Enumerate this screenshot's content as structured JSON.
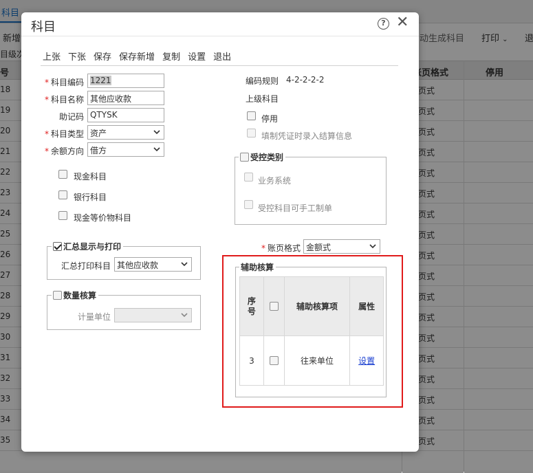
{
  "background": {
    "tab": "科目",
    "toolbar": {
      "new": "新增",
      "auto_generate": "动生成科目",
      "print": "打印",
      "exit": "退"
    },
    "sub_label": "目级次",
    "columns": {
      "seq": "号",
      "ledger_format": "账页格式",
      "disabled": "停用"
    },
    "rows": [
      {
        "num": "18",
        "format": "页式"
      },
      {
        "num": "19",
        "format": "页式"
      },
      {
        "num": "20",
        "format": "页式"
      },
      {
        "num": "21",
        "format": "页式"
      },
      {
        "num": "22",
        "format": "页式"
      },
      {
        "num": "23",
        "format": "页式"
      },
      {
        "num": "24",
        "format": "页式"
      },
      {
        "num": "25",
        "format": "页式"
      },
      {
        "num": "26",
        "format": "页式"
      },
      {
        "num": "27",
        "format": "页式"
      },
      {
        "num": "28",
        "format": "页式"
      },
      {
        "num": "29",
        "format": "页式"
      },
      {
        "num": "30",
        "format": "页式"
      },
      {
        "num": "31",
        "format": "页式"
      },
      {
        "num": "32",
        "format": "页式"
      },
      {
        "num": "33",
        "format": "页式"
      },
      {
        "num": "34",
        "format": "页式"
      },
      {
        "num": "35",
        "format": "页式"
      }
    ]
  },
  "dialog": {
    "title": "科目",
    "help_icon": "question-circle-icon",
    "close_icon": "close-icon",
    "toolbar": [
      "上张",
      "下张",
      "保存",
      "保存新增",
      "复制",
      "设置",
      "退出"
    ],
    "form": {
      "code_label": "科目编码",
      "code_value": "1221",
      "name_label": "科目名称",
      "name_value": "其他应收款",
      "mnemonic_label": "助记码",
      "mnemonic_value": "QTYSK",
      "type_label": "科目类型",
      "type_value": "资产",
      "balance_label": "余额方向",
      "balance_value": "借方",
      "cash_label": "现金科目",
      "bank_label": "银行科目",
      "cash_equiv_label": "现金等价物科目"
    },
    "right": {
      "code_rule_label": "编码规则",
      "code_rule_value": "4-2-2-2-2",
      "parent_label": "上级科目",
      "disabled_label": "停用",
      "settlement_label": "填制凭证时录入结算信息"
    },
    "controlled": {
      "legend": "受控类别",
      "business_system": "业务系统",
      "manual_voucher": "受控科目可手工制单"
    },
    "summary": {
      "legend": "汇总显示与打印",
      "print_label": "汇总打印科目",
      "print_value": "其他应收款"
    },
    "quantity": {
      "legend": "数量核算",
      "unit_label": "计量单位",
      "unit_value": ""
    },
    "ledger_format": {
      "label": "账页格式",
      "value": "金额式"
    },
    "aux": {
      "legend": "辅助核算",
      "headers": {
        "seq": "序号",
        "item": "辅助核算项",
        "attr": "属性"
      },
      "rows": [
        {
          "seq": "3",
          "item": "往来单位",
          "attr": "设置"
        }
      ]
    }
  },
  "colors": {
    "highlight": "#e01a1a",
    "link": "#1a3fd0",
    "required": "#e02020"
  }
}
